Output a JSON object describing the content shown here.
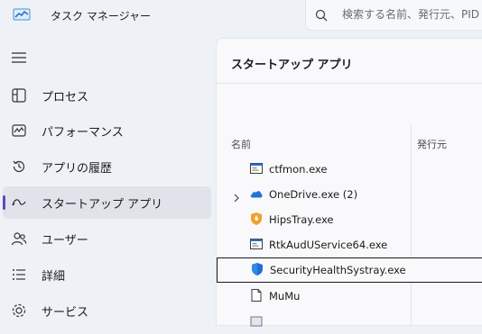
{
  "titlebar": {
    "title": "タスク マネージャー"
  },
  "search": {
    "placeholder": "検索する名前、発行元、PID"
  },
  "nav": {
    "items": [
      {
        "label": "プロセス",
        "icon": "processes-icon"
      },
      {
        "label": "パフォーマンス",
        "icon": "performance-icon"
      },
      {
        "label": "アプリの履歴",
        "icon": "app-history-icon"
      },
      {
        "label": "スタートアップ アプリ",
        "icon": "startup-apps-icon",
        "active": true
      },
      {
        "label": "ユーザー",
        "icon": "users-icon"
      },
      {
        "label": "詳細",
        "icon": "details-icon"
      },
      {
        "label": "サービス",
        "icon": "services-icon"
      }
    ]
  },
  "main": {
    "title": "スタートアップ アプリ",
    "columns": {
      "name": "名前",
      "publisher": "発行元"
    },
    "rows": [
      {
        "name": "ctfmon.exe",
        "icon": "exe-window-icon"
      },
      {
        "name": "OneDrive.exe (2)",
        "icon": "onedrive-cloud-icon",
        "expandable": true
      },
      {
        "name": "HipsTray.exe",
        "icon": "hipstray-shield-icon"
      },
      {
        "name": "RtkAudUService64.exe",
        "icon": "exe-window-icon"
      },
      {
        "name": "SecurityHealthSystray.exe",
        "icon": "windows-security-shield-icon",
        "selected": true
      },
      {
        "name": "MuMu",
        "icon": "blank-file-icon"
      }
    ]
  },
  "colors": {
    "accent": "#5a4ac2",
    "background": "#eef2f7",
    "panel": "#f9f9fb"
  }
}
